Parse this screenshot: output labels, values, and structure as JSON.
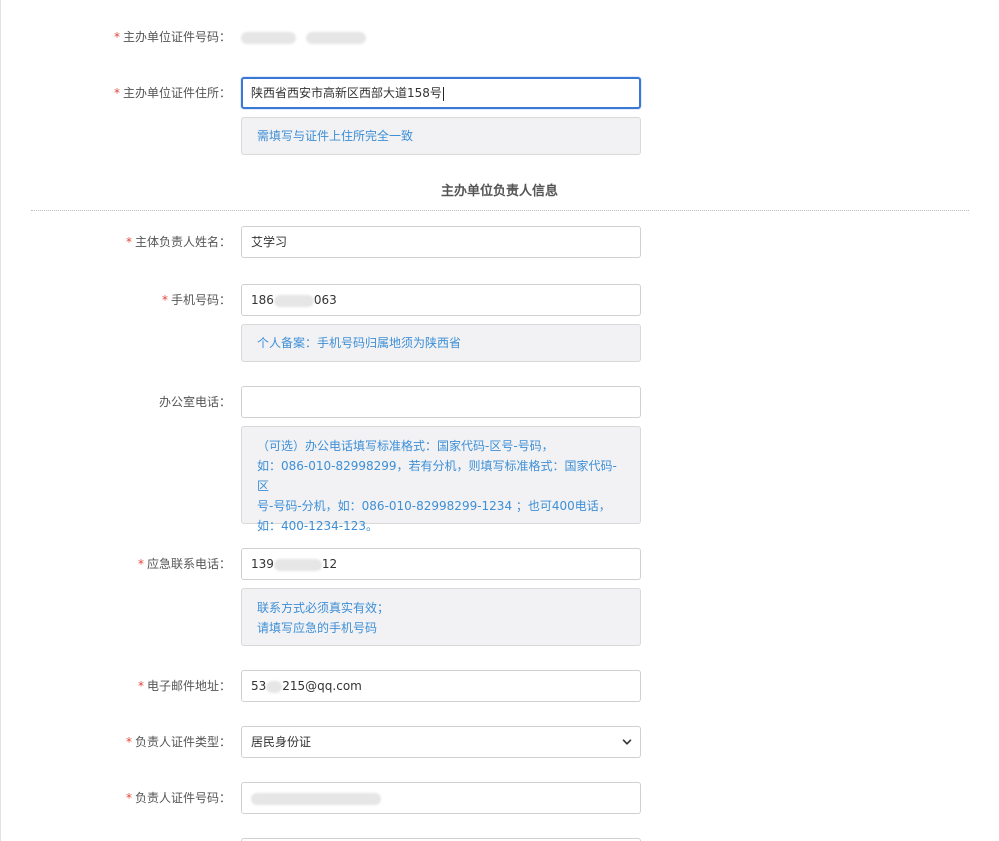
{
  "required_mark": "*",
  "fields": {
    "org_id_number": {
      "label": "主办单位证件号码：",
      "value": ""
    },
    "org_id_address": {
      "label": "主办单位证件住所：",
      "value": "陕西省西安市高新区西部大道158号",
      "hint": "需填写与证件上住所完全一致"
    },
    "section_title": "主办单位负责人信息",
    "person_name": {
      "label": "主体负责人姓名：",
      "value": "艾学习"
    },
    "mobile": {
      "label": "手机号码：",
      "value_prefix": "186",
      "value_suffix": "063",
      "hint": "个人备案：手机号码归属地须为陕西省"
    },
    "office_phone": {
      "label": "办公室电话：",
      "value": "",
      "hint_lines": [
        "（可选）办公电话填写标准格式：国家代码-区号-号码，",
        "如：086-010-82998299，若有分机，则填写标准格式：国家代码-区",
        "号-号码-分机，如：086-010-82998299-1234 ；也可400电话，",
        "如：400-1234-123。"
      ]
    },
    "emergency_phone": {
      "label": "应急联系电话：",
      "value_prefix": "139",
      "value_suffix": "12",
      "hint_lines": [
        "联系方式必须真实有效；",
        "请填写应急的手机号码"
      ]
    },
    "email": {
      "label": "电子邮件地址：",
      "value_prefix": "53",
      "value_suffix": "215@qq.com"
    },
    "id_type": {
      "label": "负责人证件类型：",
      "value": "居民身份证"
    },
    "id_number": {
      "label": "负责人证件号码：",
      "value": ""
    }
  },
  "colors": {
    "required": "#e0473a",
    "hint_text": "#3d8fd6",
    "hint_bg": "#f2f2f4",
    "focus_border": "#3a78d6"
  },
  "icons": {
    "select_arrow": "chevron-down-icon"
  }
}
